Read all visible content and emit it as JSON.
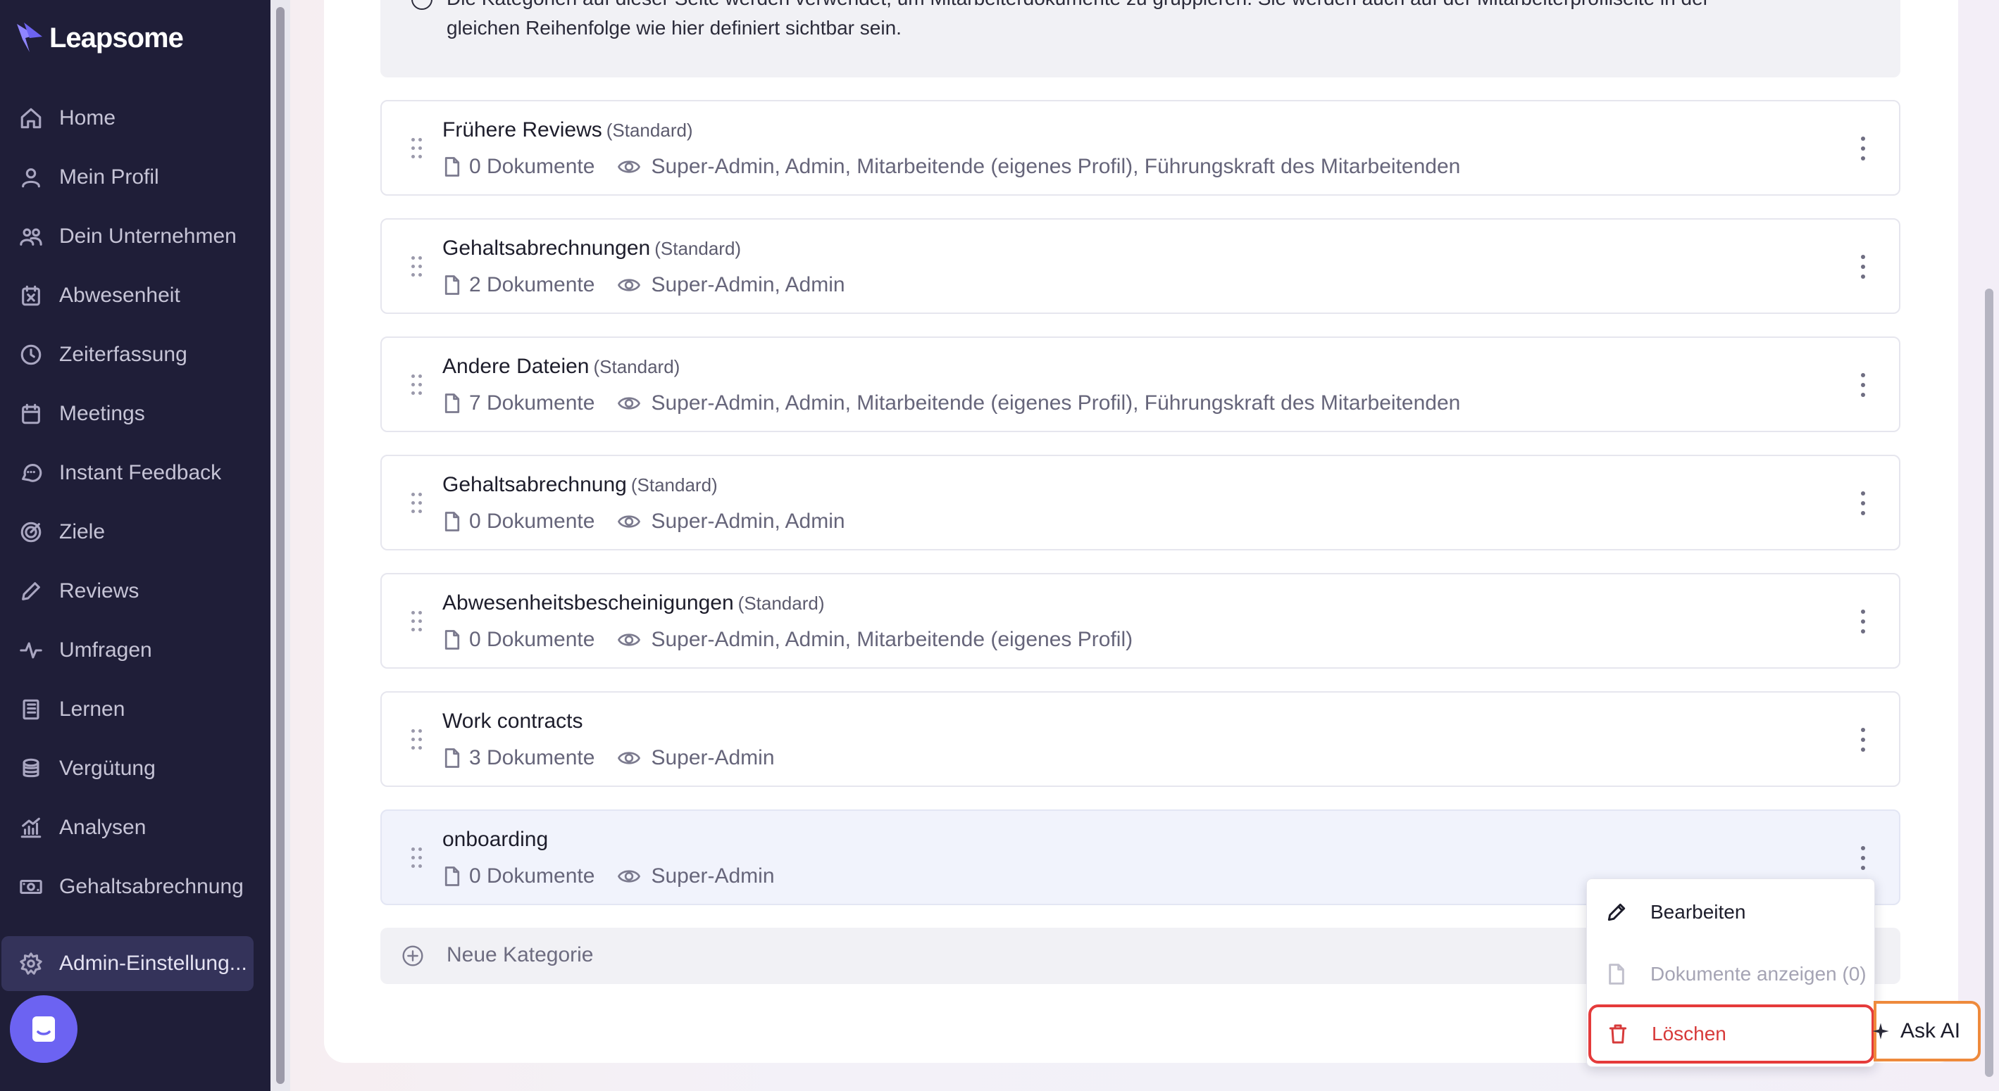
{
  "brand": {
    "name": "Leapsome"
  },
  "sidebar": {
    "items": [
      {
        "label": "Home",
        "icon": "home-icon"
      },
      {
        "label": "Mein Profil",
        "icon": "user-icon"
      },
      {
        "label": "Dein Unternehmen",
        "icon": "users-icon"
      },
      {
        "label": "Abwesenheit",
        "icon": "calendar-x-icon"
      },
      {
        "label": "Zeiterfassung",
        "icon": "clock-icon"
      },
      {
        "label": "Meetings",
        "icon": "calendar-icon"
      },
      {
        "label": "Instant Feedback",
        "icon": "chat-icon"
      },
      {
        "label": "Ziele",
        "icon": "target-icon"
      },
      {
        "label": "Reviews",
        "icon": "pen-icon"
      },
      {
        "label": "Umfragen",
        "icon": "pulse-icon"
      },
      {
        "label": "Lernen",
        "icon": "book-icon"
      },
      {
        "label": "Vergütung",
        "icon": "coins-icon"
      },
      {
        "label": "Analysen",
        "icon": "chart-icon"
      },
      {
        "label": "Gehaltsabrechnung",
        "icon": "money-icon"
      }
    ],
    "active": {
      "label": "Admin-Einstellung...",
      "icon": "gear-icon"
    }
  },
  "info": {
    "line1": "Die Kategorien auf dieser Seite werden verwendet, um Mitarbeiterdokumente zu gruppieren. Sie werden auch auf der Mitarbeiterprofilseite in der",
    "line2": "gleichen Reihenfolge wie hier definiert sichtbar sein."
  },
  "categories": [
    {
      "name": "Frühere Reviews",
      "standard": "(Standard)",
      "docs": "0 Dokumente",
      "visibility": "Super-Admin, Admin, Mitarbeitende (eigenes Profil), Führungskraft des Mitarbeitenden"
    },
    {
      "name": "Gehaltsabrechnungen",
      "standard": "(Standard)",
      "docs": "2 Dokumente",
      "visibility": "Super-Admin, Admin"
    },
    {
      "name": "Andere Dateien",
      "standard": "(Standard)",
      "docs": "7 Dokumente",
      "visibility": "Super-Admin, Admin, Mitarbeitende (eigenes Profil), Führungskraft des Mitarbeitenden"
    },
    {
      "name": "Gehaltsabrechnung",
      "standard": "(Standard)",
      "docs": "0 Dokumente",
      "visibility": "Super-Admin, Admin"
    },
    {
      "name": "Abwesenheitsbescheinigungen",
      "standard": "(Standard)",
      "docs": "0 Dokumente",
      "visibility": "Super-Admin, Admin, Mitarbeitende (eigenes Profil)"
    },
    {
      "name": "Work contracts",
      "standard": "",
      "docs": "3 Dokumente",
      "visibility": "Super-Admin"
    },
    {
      "name": "onboarding",
      "standard": "",
      "docs": "0 Dokumente",
      "visibility": "Super-Admin"
    }
  ],
  "new_category": {
    "label": "Neue Kategorie"
  },
  "menu": {
    "edit": "Bearbeiten",
    "view": "Dokumente anzeigen (0)",
    "delete": "Löschen"
  },
  "ask_ai": {
    "label": "Ask AI"
  },
  "colors": {
    "sidebar": "#1f1e38",
    "accent": "#6c63f2",
    "danger": "#d73a3a",
    "ask_ai_border": "#ee8a3c"
  }
}
